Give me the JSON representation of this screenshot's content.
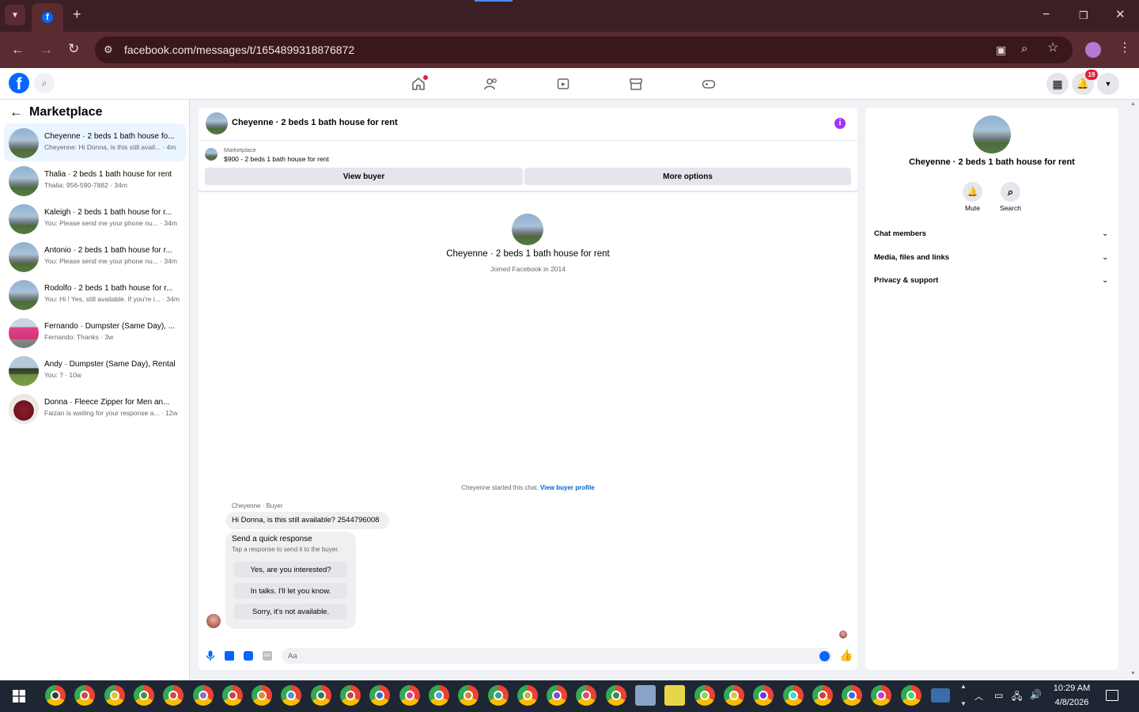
{
  "browser": {
    "url": "facebook.com/messages/t/1654899318876872",
    "new_tab": "+",
    "win_min": "−",
    "win_max": "❐",
    "win_close": "✕"
  },
  "fb": {
    "notif_count": "19"
  },
  "left": {
    "title": "Marketplace",
    "conversations": [
      {
        "name": "Cheyenne · 2 beds 1 bath house fo...",
        "preview": "Cheyenne: Hi Donna, is this still avail... · 4m"
      },
      {
        "name": "Thalia · 2 beds 1 bath house for rent",
        "preview": "Thalia: 956-590-7882 · 34m"
      },
      {
        "name": "Kaleigh · 2 beds 1 bath house for r...",
        "preview": "You: Please send me your phone nu... · 34m"
      },
      {
        "name": "Antonio · 2 beds 1 bath house for r...",
        "preview": "You: Please send me your phone nu... · 34m"
      },
      {
        "name": "Rodolfo · 2 beds 1 bath house for r...",
        "preview": "You: Hi ! Yes, still available. If you're i... · 34m"
      },
      {
        "name": "Fernando · Dumpster (Same Day), ...",
        "preview": "Fernando: Thanks · 3w"
      },
      {
        "name": "Andy · Dumpster (Same Day), Rental",
        "preview": "You: ? · 10w"
      },
      {
        "name": "Donna · Fleece Zipper for Men an...",
        "preview": "Faizan is waiting for your response a... · 12w"
      }
    ]
  },
  "chat": {
    "header_title": "Cheyenne · 2 beds 1 bath house for rent",
    "listing_source": "Marketplace",
    "listing_title": "$900 - 2 beds 1 bath house for rent",
    "view_buyer": "View buyer",
    "more_options": "More options",
    "profile_name": "Cheyenne · 2 beds 1 bath house for rent",
    "joined": "Joined Facebook in 2014",
    "started": "Cheyenne started this chat.",
    "view_profile": "View buyer profile",
    "sender_label": "Cheyenne · Buyer",
    "message": "Hi Donna, is this still available? 2544796008",
    "quick_title": "Send a quick response",
    "quick_sub": "Tap a response to send it to the buyer.",
    "quick_replies": [
      "Yes, are you interested?",
      "In talks. I'll let you know.",
      "Sorry, it's not available."
    ],
    "composer_placeholder": "Aa"
  },
  "right": {
    "name": "Cheyenne · 2 beds 1 bath house for rent",
    "mute": "Mute",
    "search": "Search",
    "sections": [
      "Chat members",
      "Media, files and links",
      "Privacy & support"
    ]
  },
  "taskbar": {
    "time": "10:29 AM",
    "date": "4/8/2026"
  },
  "colors": {
    "fb_blue": "#0866ff",
    "messenger_purple": "#a033ff",
    "notif_red": "#e41e3f"
  }
}
